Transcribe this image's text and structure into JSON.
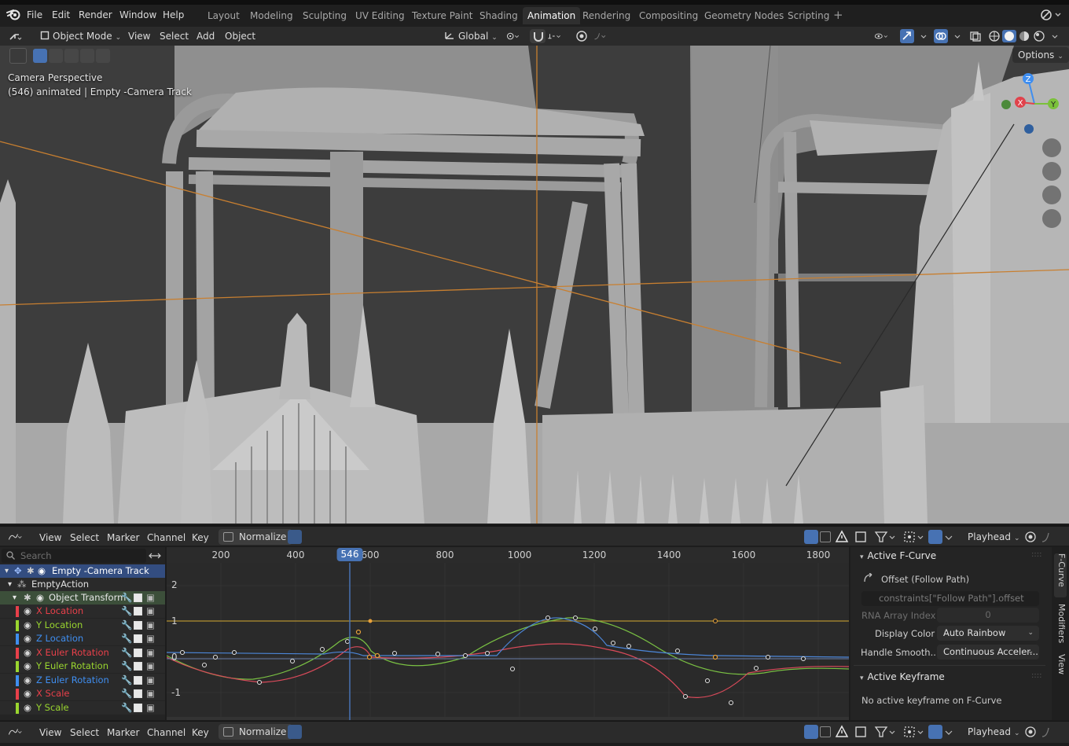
{
  "menubar": {
    "items": [
      "File",
      "Edit",
      "Render",
      "Window",
      "Help"
    ],
    "workspaces": [
      "Layout",
      "Modeling",
      "Sculpting",
      "UV Editing",
      "Texture Paint",
      "Shading",
      "Animation",
      "Rendering",
      "Compositing",
      "Geometry Nodes",
      "Scripting"
    ],
    "active_workspace": "Animation"
  },
  "viewport_header": {
    "mode": "Object Mode",
    "menus": [
      "View",
      "Select",
      "Add",
      "Object"
    ],
    "transform_orientation": "Global",
    "options_label": "Options"
  },
  "viewport": {
    "view_name": "Camera Perspective",
    "info": "(546) animated  | Empty -Camera Track",
    "gizmo_axes": [
      "X",
      "Y",
      "Z"
    ]
  },
  "graph_editor": {
    "menus": [
      "View",
      "Select",
      "Marker",
      "Channel",
      "Key"
    ],
    "normalize_label": "Normalize",
    "playhead_label": "Playhead",
    "current_frame": "546",
    "frame_ticks": [
      "200",
      "400",
      "600",
      "800",
      "1000",
      "1200",
      "1400",
      "1600",
      "1800"
    ],
    "y_ticks": [
      "2",
      "1",
      "0",
      "-1"
    ],
    "search_placeholder": "Search"
  },
  "channels": {
    "object": "Empty -Camera Track",
    "action": "EmptyAction",
    "group": "Object Transform",
    "curves": [
      {
        "label": "X Location",
        "color": "#e8404a"
      },
      {
        "label": "Y Location",
        "color": "#9ad62f"
      },
      {
        "label": "Z Location",
        "color": "#3f8ef0"
      },
      {
        "label": "X Euler Rotation",
        "color": "#e8404a"
      },
      {
        "label": "Y Euler Rotation",
        "color": "#9ad62f"
      },
      {
        "label": "Z Euler Rotation",
        "color": "#3f8ef0"
      },
      {
        "label": "X Scale",
        "color": "#e8404a"
      },
      {
        "label": "Y Scale",
        "color": "#9ad62f"
      }
    ]
  },
  "sidebar": {
    "active_fcurve_header": "Active F-Curve",
    "fcurve_name": "Offset (Follow Path)",
    "data_path": "constraints[\"Follow Path\"].offset",
    "rna_index_label": "RNA Array Index",
    "rna_index_value": "0",
    "display_color_label": "Display Color",
    "display_color_value": "Auto Rainbow",
    "handle_smooth_label": "Handle Smooth...",
    "handle_smooth_value": "Continuous Acceler...",
    "active_keyframe_header": "Active Keyframe",
    "no_keyframe_text": "No active keyframe on F-Curve",
    "tabs": [
      "F-Curve",
      "Modifiers",
      "View"
    ]
  },
  "colors": {
    "accent": "#4772b3",
    "orange_curve": "#e8a13c",
    "selected_key": "#ff9c1a"
  }
}
